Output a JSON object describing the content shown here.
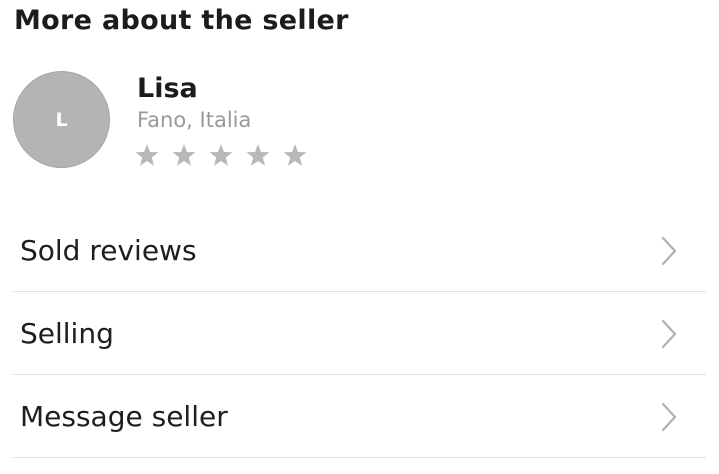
{
  "section": {
    "title": "More about the seller"
  },
  "seller": {
    "initial": "L",
    "name": "Lisa",
    "location": "Fano, Italia",
    "rating": {
      "filled": 0,
      "max": 5
    }
  },
  "menu": {
    "items": [
      {
        "label": "Sold reviews",
        "icon": "chevron-right-icon"
      },
      {
        "label": "Selling",
        "icon": "chevron-right-icon"
      },
      {
        "label": "Message seller",
        "icon": "chevron-right-icon"
      }
    ]
  },
  "colors": {
    "avatar_bg": "#b4b4b4",
    "star_empty": "#b8b8b8",
    "muted_text": "#9a9a9a",
    "divider": "#e1e1e1",
    "chevron": "#b0b0b0"
  }
}
